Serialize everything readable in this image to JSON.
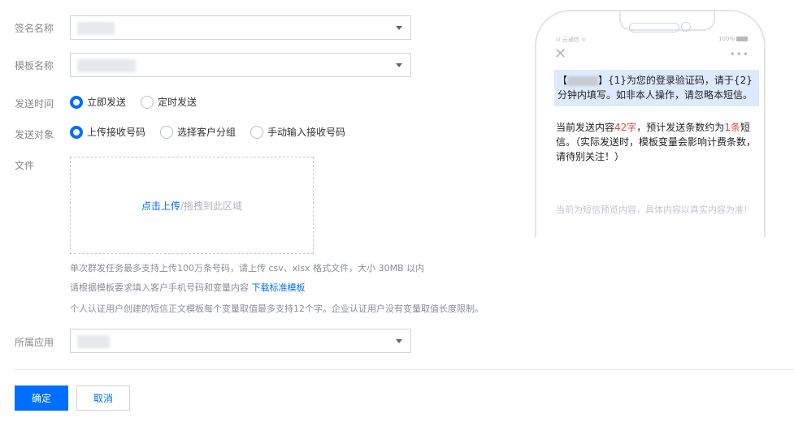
{
  "form": {
    "signature": {
      "label": "签名名称"
    },
    "template": {
      "label": "模板名称"
    },
    "send_time": {
      "label": "发送时间",
      "options": [
        "立即发送",
        "定时发送"
      ],
      "selected": 0
    },
    "send_target": {
      "label": "发送对象",
      "options": [
        "上传接收号码",
        "选择客户分组",
        "手动输入接收号码"
      ],
      "selected": 0
    },
    "file": {
      "label": "文件",
      "upload_link": "点击上传",
      "upload_hint": "/拖拽到此区域"
    },
    "notes": {
      "line1": "单次群发任务最多支持上传100万条号码，请上传 csv、xlsx 格式文件，大小 30MB 以内",
      "line2_prefix": "请根据模板要求填入客户手机号码和变量内容",
      "line2_link": "下载标准模板",
      "line3": "个人认证用户创建的短信正文模板每个变量取值最多支持12个字。企业认证用户没有变量取值长度限制。"
    },
    "app": {
      "label": "所属应用"
    }
  },
  "actions": {
    "confirm": "确定",
    "cancel": "取消"
  },
  "preview": {
    "status_left": "ııl 云通信 ᯤ",
    "status_right": "100%",
    "close_glyph": "✕",
    "more_glyph": "•••",
    "sms_open": "【",
    "sms_close": "】",
    "sms_body": "{1}为您的登录验证码，请于{2}分钟内填写。如非本人操作，请忽略本短信。",
    "info_prefix": "当前发送内容",
    "info_count": "42字",
    "info_mid": "，预计发送条数约为",
    "info_sms_count": "1条",
    "info_suffix": "短信。（实际发送时，模板变量会影响计费条数，请待别关注！）",
    "disclaimer": "当前为短信预览内容，具体内容以真实内容为准!"
  },
  "colors": {
    "primary": "#006eff",
    "highlight": "#e54545",
    "sms_bg": "#ddeafd"
  }
}
